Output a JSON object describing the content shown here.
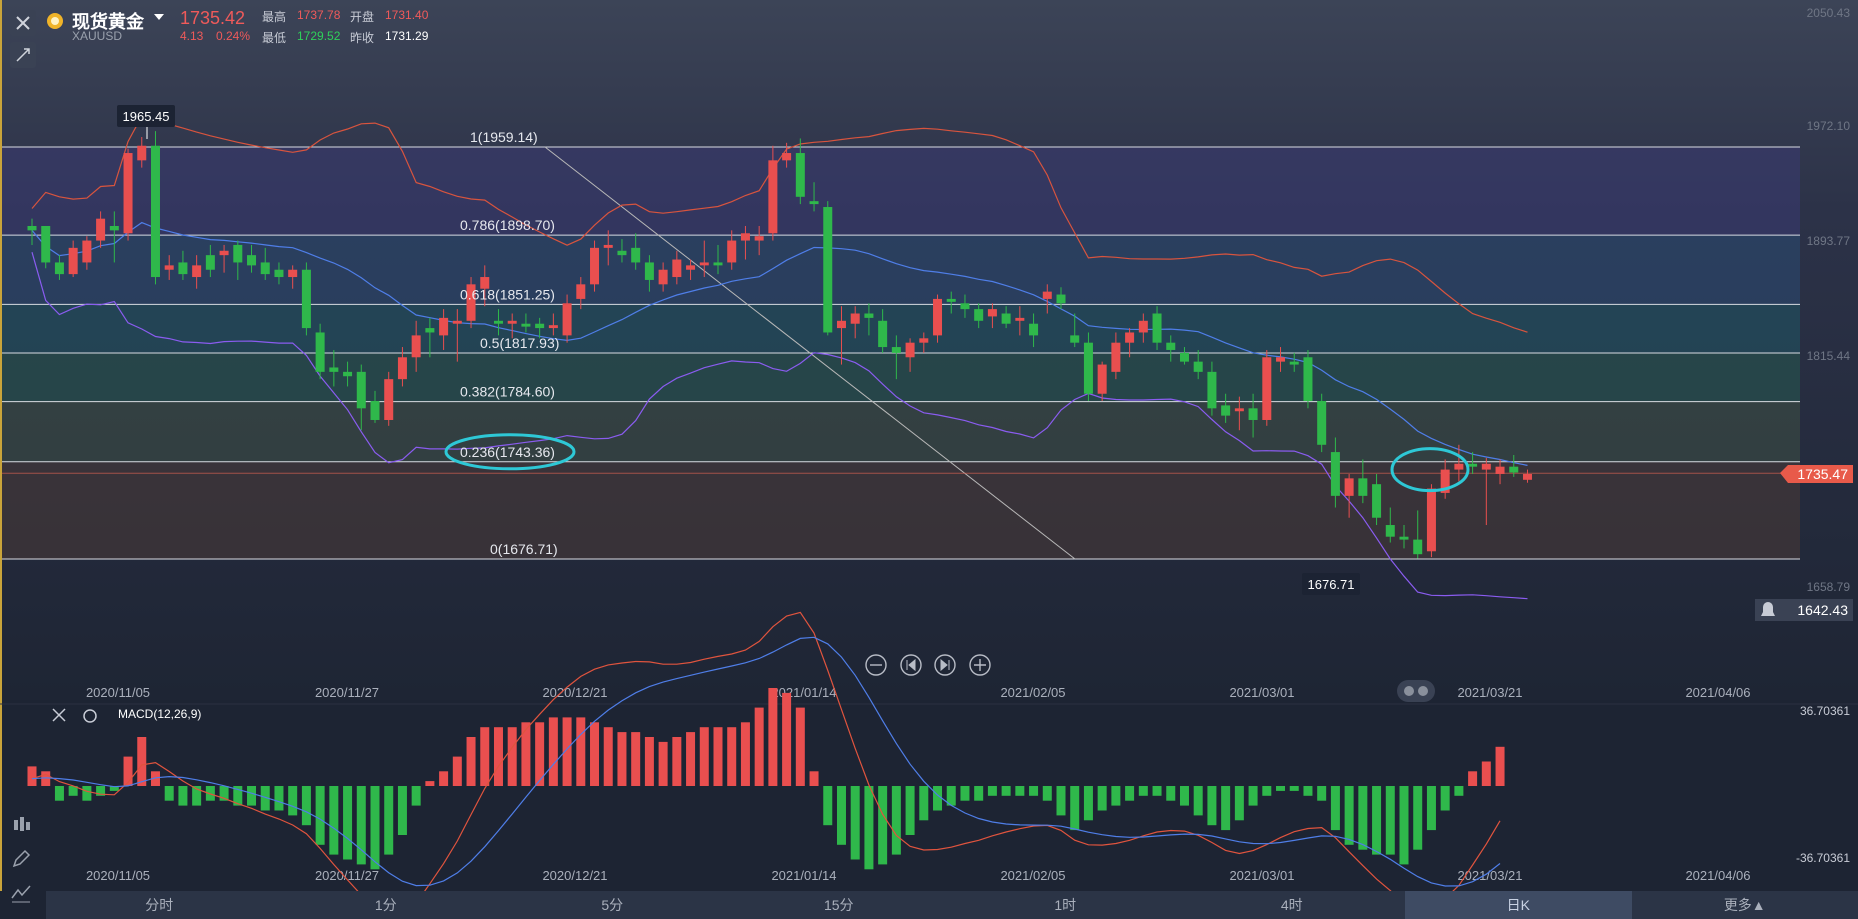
{
  "header": {
    "title": "现货黄金",
    "symbol": "XAUUSD",
    "price": "1735.42",
    "change": "4.13",
    "change_pct": "0.24%",
    "high_label": "最高",
    "high": "1737.78",
    "low_label": "最低",
    "low": "1729.52",
    "open_label": "开盘",
    "open": "1731.40",
    "prev_close_label": "昨收",
    "prev_close": "1731.29"
  },
  "colors": {
    "up": "#e94f4f",
    "down": "#2fb84b",
    "bg": "#1d2433",
    "accent_circle": "#2ec8d6"
  },
  "icons": [
    "close-icon",
    "draw-icon",
    "zoom-out-icon",
    "prev-icon",
    "next-icon",
    "zoom-in-icon",
    "settings-icon",
    "bell-icon",
    "candle-icon",
    "pencil-icon",
    "indicator-icon",
    "toggle-icon"
  ],
  "price_axis": {
    "labels": [
      "2050.43",
      "1972.10",
      "1893.77",
      "1815.44",
      "1658.79"
    ],
    "current_tag": "1735.47",
    "alert_price": "1642.43"
  },
  "date_axis": [
    "2020/11/05",
    "2020/11/27",
    "2020/12/21",
    "2021/01/14",
    "2021/02/05",
    "2021/03/01",
    "2021/03/21",
    "2021/04/06"
  ],
  "macd": {
    "label": "MACD(12,26,9)",
    "top": "36.70361",
    "bottom": "-36.70361"
  },
  "tabs": {
    "items": [
      "分时",
      "1分",
      "5分",
      "15分",
      "1时",
      "4时",
      "日K",
      "更多▲"
    ],
    "active": "日K"
  },
  "chart_data": {
    "type": "candlestick",
    "markers": {
      "high": "1965.45",
      "low": "1676.71"
    },
    "fibonacci": [
      {
        "label": "1(1959.14)",
        "level": 1959.14
      },
      {
        "label": "0.786(1898.70)",
        "level": 1898.7
      },
      {
        "label": "0.618(1851.25)",
        "level": 1851.25
      },
      {
        "label": "0.5(1817.93)",
        "level": 1817.93
      },
      {
        "label": "0.382(1784.60)",
        "level": 1784.6
      },
      {
        "label": "0.236(1743.36)",
        "level": 1743.36
      },
      {
        "label": "0(1676.71)",
        "level": 1676.71
      }
    ],
    "candles": [
      [
        1905,
        1910,
        1892,
        1902
      ],
      [
        1905,
        1905,
        1876,
        1880
      ],
      [
        1880,
        1885,
        1868,
        1872
      ],
      [
        1872,
        1895,
        1870,
        1890
      ],
      [
        1880,
        1898,
        1875,
        1895
      ],
      [
        1895,
        1915,
        1890,
        1910
      ],
      [
        1905,
        1915,
        1880,
        1902
      ],
      [
        1900,
        1958,
        1895,
        1955
      ],
      [
        1950,
        1966,
        1945,
        1960
      ],
      [
        1960,
        1970,
        1865,
        1870
      ],
      [
        1875,
        1885,
        1868,
        1878
      ],
      [
        1880,
        1888,
        1868,
        1872
      ],
      [
        1870,
        1885,
        1862,
        1878
      ],
      [
        1885,
        1892,
        1870,
        1875
      ],
      [
        1885,
        1892,
        1873,
        1888
      ],
      [
        1892,
        1895,
        1868,
        1880
      ],
      [
        1885,
        1892,
        1873,
        1878
      ],
      [
        1880,
        1890,
        1868,
        1872
      ],
      [
        1875,
        1880,
        1865,
        1870
      ],
      [
        1870,
        1878,
        1862,
        1875
      ],
      [
        1875,
        1880,
        1830,
        1835
      ],
      [
        1832,
        1838,
        1800,
        1805
      ],
      [
        1808,
        1820,
        1795,
        1805
      ],
      [
        1805,
        1812,
        1795,
        1802
      ],
      [
        1805,
        1810,
        1765,
        1780
      ],
      [
        1785,
        1792,
        1770,
        1772
      ],
      [
        1772,
        1805,
        1768,
        1800
      ],
      [
        1800,
        1822,
        1795,
        1815
      ],
      [
        1815,
        1840,
        1805,
        1830
      ],
      [
        1835,
        1842,
        1815,
        1832
      ],
      [
        1830,
        1848,
        1820,
        1842
      ],
      [
        1838,
        1848,
        1812,
        1840
      ],
      [
        1840,
        1870,
        1835,
        1865
      ],
      [
        1862,
        1878,
        1850,
        1870
      ],
      [
        1840,
        1848,
        1830,
        1838
      ],
      [
        1838,
        1845,
        1828,
        1840
      ],
      [
        1838,
        1845,
        1832,
        1836
      ],
      [
        1838,
        1842,
        1828,
        1835
      ],
      [
        1835,
        1845,
        1830,
        1837
      ],
      [
        1830,
        1858,
        1825,
        1852
      ],
      [
        1855,
        1870,
        1848,
        1865
      ],
      [
        1865,
        1895,
        1860,
        1890
      ],
      [
        1890,
        1902,
        1878,
        1892
      ],
      [
        1888,
        1896,
        1880,
        1885
      ],
      [
        1890,
        1900,
        1875,
        1880
      ],
      [
        1880,
        1885,
        1860,
        1868
      ],
      [
        1865,
        1880,
        1860,
        1875
      ],
      [
        1870,
        1888,
        1865,
        1882
      ],
      [
        1875,
        1882,
        1868,
        1878
      ],
      [
        1878,
        1895,
        1870,
        1880
      ],
      [
        1880,
        1892,
        1872,
        1878
      ],
      [
        1880,
        1902,
        1875,
        1895
      ],
      [
        1895,
        1905,
        1882,
        1900
      ],
      [
        1895,
        1905,
        1885,
        1898
      ],
      [
        1900,
        1960,
        1895,
        1950
      ],
      [
        1950,
        1962,
        1945,
        1955
      ],
      [
        1955,
        1965,
        1920,
        1925
      ],
      [
        1922,
        1935,
        1915,
        1920
      ],
      [
        1918,
        1922,
        1830,
        1832
      ],
      [
        1835,
        1850,
        1810,
        1840
      ],
      [
        1838,
        1850,
        1828,
        1845
      ],
      [
        1845,
        1852,
        1830,
        1842
      ],
      [
        1840,
        1848,
        1818,
        1822
      ],
      [
        1822,
        1830,
        1800,
        1818
      ],
      [
        1815,
        1828,
        1805,
        1825
      ],
      [
        1825,
        1832,
        1818,
        1828
      ],
      [
        1830,
        1858,
        1825,
        1855
      ],
      [
        1855,
        1860,
        1845,
        1853
      ],
      [
        1852,
        1858,
        1842,
        1848
      ],
      [
        1848,
        1852,
        1835,
        1840
      ],
      [
        1843,
        1852,
        1835,
        1848
      ],
      [
        1845,
        1850,
        1835,
        1838
      ],
      [
        1840,
        1850,
        1830,
        1842
      ],
      [
        1838,
        1845,
        1822,
        1830
      ],
      [
        1855,
        1865,
        1845,
        1860
      ],
      [
        1858,
        1863,
        1848,
        1852
      ],
      [
        1830,
        1845,
        1822,
        1825
      ],
      [
        1825,
        1832,
        1785,
        1790
      ],
      [
        1790,
        1812,
        1785,
        1810
      ],
      [
        1805,
        1832,
        1800,
        1825
      ],
      [
        1825,
        1835,
        1815,
        1832
      ],
      [
        1832,
        1845,
        1825,
        1840
      ],
      [
        1845,
        1850,
        1820,
        1825
      ],
      [
        1825,
        1830,
        1812,
        1820
      ],
      [
        1818,
        1822,
        1810,
        1812
      ],
      [
        1812,
        1820,
        1800,
        1805
      ],
      [
        1805,
        1812,
        1775,
        1780
      ],
      [
        1782,
        1790,
        1770,
        1775
      ],
      [
        1778,
        1788,
        1765,
        1780
      ],
      [
        1780,
        1790,
        1760,
        1772
      ],
      [
        1772,
        1820,
        1768,
        1815
      ],
      [
        1812,
        1822,
        1805,
        1815
      ],
      [
        1812,
        1818,
        1805,
        1810
      ],
      [
        1815,
        1820,
        1780,
        1785
      ],
      [
        1785,
        1790,
        1750,
        1755
      ],
      [
        1750,
        1760,
        1712,
        1720
      ],
      [
        1720,
        1735,
        1705,
        1732
      ],
      [
        1732,
        1745,
        1715,
        1720
      ],
      [
        1728,
        1735,
        1700,
        1705
      ],
      [
        1700,
        1712,
        1688,
        1692
      ],
      [
        1692,
        1700,
        1684,
        1690
      ],
      [
        1690,
        1710,
        1677,
        1680
      ],
      [
        1682,
        1728,
        1678,
        1725
      ],
      [
        1722,
        1745,
        1718,
        1738
      ],
      [
        1738,
        1755,
        1730,
        1742
      ],
      [
        1742,
        1750,
        1735,
        1740
      ],
      [
        1738,
        1746,
        1700,
        1742
      ],
      [
        1735,
        1745,
        1728,
        1740
      ],
      [
        1740,
        1748,
        1733,
        1736
      ],
      [
        1731,
        1738,
        1729,
        1735
      ]
    ],
    "macd_hist": [
      4,
      3,
      -3,
      -2,
      -3,
      -2,
      -1,
      6,
      10,
      3,
      -3,
      -4,
      -4,
      -3,
      -3,
      -4,
      -4,
      -5,
      -5,
      -6,
      -8,
      -12,
      -14,
      -15,
      -16,
      -17,
      -14,
      -10,
      -4,
      1,
      3,
      6,
      10,
      12,
      12,
      12,
      13,
      13,
      14,
      14,
      14,
      13,
      12,
      11,
      11,
      10,
      9,
      10,
      11,
      12,
      12,
      12,
      13,
      16,
      20,
      19,
      16,
      3,
      -8,
      -12,
      -15,
      -17,
      -16,
      -14,
      -10,
      -7,
      -5,
      -4,
      -3,
      -3,
      -2,
      -2,
      -2,
      -2,
      -3,
      -6,
      -9,
      -7,
      -5,
      -4,
      -3,
      -2,
      -2,
      -3,
      -4,
      -6,
      -8,
      -9,
      -7,
      -4,
      -2,
      -1,
      -1,
      -2,
      -3,
      -9,
      -12,
      -13,
      -14,
      -14,
      -16,
      -13,
      -9,
      -5,
      -2,
      3,
      5,
      8
    ]
  }
}
